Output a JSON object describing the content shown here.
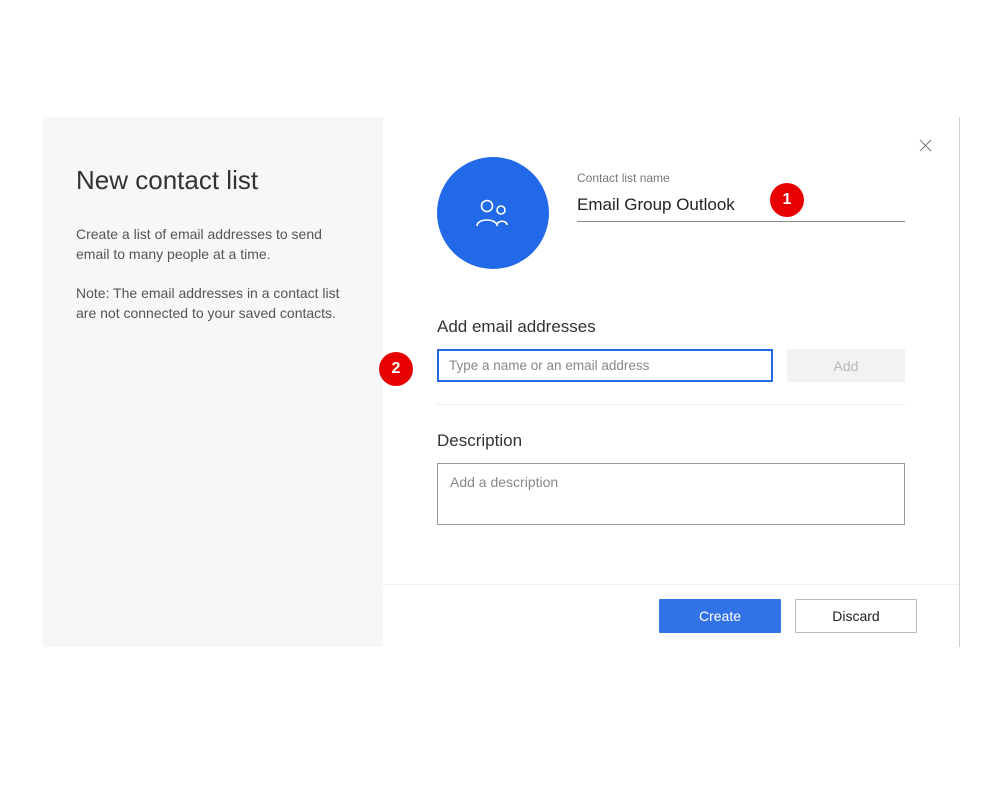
{
  "sidebar": {
    "title": "New contact list",
    "intro": "Create a list of email addresses to send email to many people at a time.",
    "note": "Note: The email addresses in a contact list are not connected to your saved contacts."
  },
  "main": {
    "name_label": "Contact list name",
    "name_value": "Email Group Outlook",
    "email_section_label": "Add email addresses",
    "email_placeholder": "Type a name or an email address",
    "add_button": "Add",
    "desc_label": "Description",
    "desc_placeholder": "Add a description"
  },
  "buttons": {
    "create": "Create",
    "discard": "Discard"
  },
  "markers": {
    "one": "1",
    "two": "2"
  }
}
